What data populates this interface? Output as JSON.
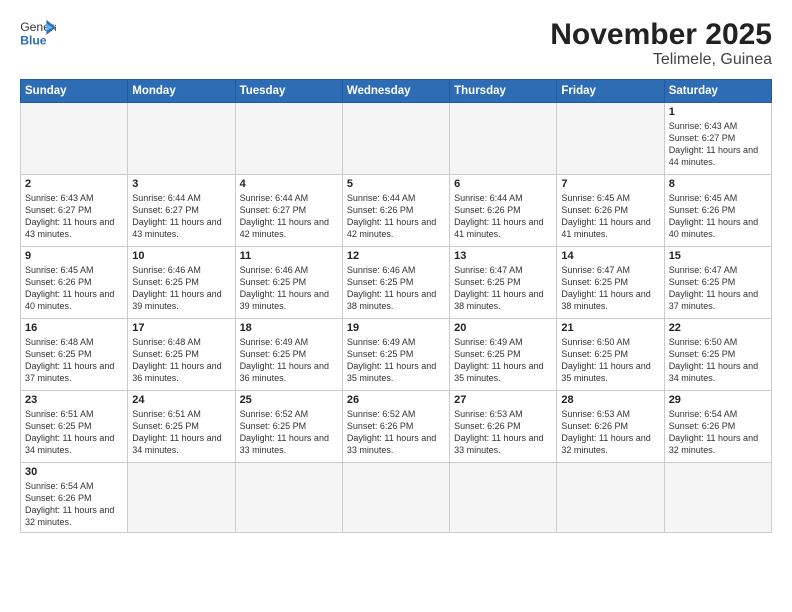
{
  "header": {
    "logo_general": "General",
    "logo_blue": "Blue",
    "title": "November 2025",
    "subtitle": "Telimele, Guinea"
  },
  "weekdays": [
    "Sunday",
    "Monday",
    "Tuesday",
    "Wednesday",
    "Thursday",
    "Friday",
    "Saturday"
  ],
  "weeks": [
    [
      {
        "day": "",
        "info": ""
      },
      {
        "day": "",
        "info": ""
      },
      {
        "day": "",
        "info": ""
      },
      {
        "day": "",
        "info": ""
      },
      {
        "day": "",
        "info": ""
      },
      {
        "day": "",
        "info": ""
      },
      {
        "day": "1",
        "info": "Sunrise: 6:43 AM\nSunset: 6:27 PM\nDaylight: 11 hours\nand 44 minutes."
      }
    ],
    [
      {
        "day": "2",
        "info": "Sunrise: 6:43 AM\nSunset: 6:27 PM\nDaylight: 11 hours\nand 43 minutes."
      },
      {
        "day": "3",
        "info": "Sunrise: 6:44 AM\nSunset: 6:27 PM\nDaylight: 11 hours\nand 43 minutes."
      },
      {
        "day": "4",
        "info": "Sunrise: 6:44 AM\nSunset: 6:27 PM\nDaylight: 11 hours\nand 42 minutes."
      },
      {
        "day": "5",
        "info": "Sunrise: 6:44 AM\nSunset: 6:26 PM\nDaylight: 11 hours\nand 42 minutes."
      },
      {
        "day": "6",
        "info": "Sunrise: 6:44 AM\nSunset: 6:26 PM\nDaylight: 11 hours\nand 41 minutes."
      },
      {
        "day": "7",
        "info": "Sunrise: 6:45 AM\nSunset: 6:26 PM\nDaylight: 11 hours\nand 41 minutes."
      },
      {
        "day": "8",
        "info": "Sunrise: 6:45 AM\nSunset: 6:26 PM\nDaylight: 11 hours\nand 40 minutes."
      }
    ],
    [
      {
        "day": "9",
        "info": "Sunrise: 6:45 AM\nSunset: 6:26 PM\nDaylight: 11 hours\nand 40 minutes."
      },
      {
        "day": "10",
        "info": "Sunrise: 6:46 AM\nSunset: 6:25 PM\nDaylight: 11 hours\nand 39 minutes."
      },
      {
        "day": "11",
        "info": "Sunrise: 6:46 AM\nSunset: 6:25 PM\nDaylight: 11 hours\nand 39 minutes."
      },
      {
        "day": "12",
        "info": "Sunrise: 6:46 AM\nSunset: 6:25 PM\nDaylight: 11 hours\nand 38 minutes."
      },
      {
        "day": "13",
        "info": "Sunrise: 6:47 AM\nSunset: 6:25 PM\nDaylight: 11 hours\nand 38 minutes."
      },
      {
        "day": "14",
        "info": "Sunrise: 6:47 AM\nSunset: 6:25 PM\nDaylight: 11 hours\nand 38 minutes."
      },
      {
        "day": "15",
        "info": "Sunrise: 6:47 AM\nSunset: 6:25 PM\nDaylight: 11 hours\nand 37 minutes."
      }
    ],
    [
      {
        "day": "16",
        "info": "Sunrise: 6:48 AM\nSunset: 6:25 PM\nDaylight: 11 hours\nand 37 minutes."
      },
      {
        "day": "17",
        "info": "Sunrise: 6:48 AM\nSunset: 6:25 PM\nDaylight: 11 hours\nand 36 minutes."
      },
      {
        "day": "18",
        "info": "Sunrise: 6:49 AM\nSunset: 6:25 PM\nDaylight: 11 hours\nand 36 minutes."
      },
      {
        "day": "19",
        "info": "Sunrise: 6:49 AM\nSunset: 6:25 PM\nDaylight: 11 hours\nand 35 minutes."
      },
      {
        "day": "20",
        "info": "Sunrise: 6:49 AM\nSunset: 6:25 PM\nDaylight: 11 hours\nand 35 minutes."
      },
      {
        "day": "21",
        "info": "Sunrise: 6:50 AM\nSunset: 6:25 PM\nDaylight: 11 hours\nand 35 minutes."
      },
      {
        "day": "22",
        "info": "Sunrise: 6:50 AM\nSunset: 6:25 PM\nDaylight: 11 hours\nand 34 minutes."
      }
    ],
    [
      {
        "day": "23",
        "info": "Sunrise: 6:51 AM\nSunset: 6:25 PM\nDaylight: 11 hours\nand 34 minutes."
      },
      {
        "day": "24",
        "info": "Sunrise: 6:51 AM\nSunset: 6:25 PM\nDaylight: 11 hours\nand 34 minutes."
      },
      {
        "day": "25",
        "info": "Sunrise: 6:52 AM\nSunset: 6:25 PM\nDaylight: 11 hours\nand 33 minutes."
      },
      {
        "day": "26",
        "info": "Sunrise: 6:52 AM\nSunset: 6:26 PM\nDaylight: 11 hours\nand 33 minutes."
      },
      {
        "day": "27",
        "info": "Sunrise: 6:53 AM\nSunset: 6:26 PM\nDaylight: 11 hours\nand 33 minutes."
      },
      {
        "day": "28",
        "info": "Sunrise: 6:53 AM\nSunset: 6:26 PM\nDaylight: 11 hours\nand 32 minutes."
      },
      {
        "day": "29",
        "info": "Sunrise: 6:54 AM\nSunset: 6:26 PM\nDaylight: 11 hours\nand 32 minutes."
      }
    ],
    [
      {
        "day": "30",
        "info": "Sunrise: 6:54 AM\nSunset: 6:26 PM\nDaylight: 11 hours\nand 32 minutes."
      },
      {
        "day": "",
        "info": ""
      },
      {
        "day": "",
        "info": ""
      },
      {
        "day": "",
        "info": ""
      },
      {
        "day": "",
        "info": ""
      },
      {
        "day": "",
        "info": ""
      },
      {
        "day": "",
        "info": ""
      }
    ]
  ]
}
